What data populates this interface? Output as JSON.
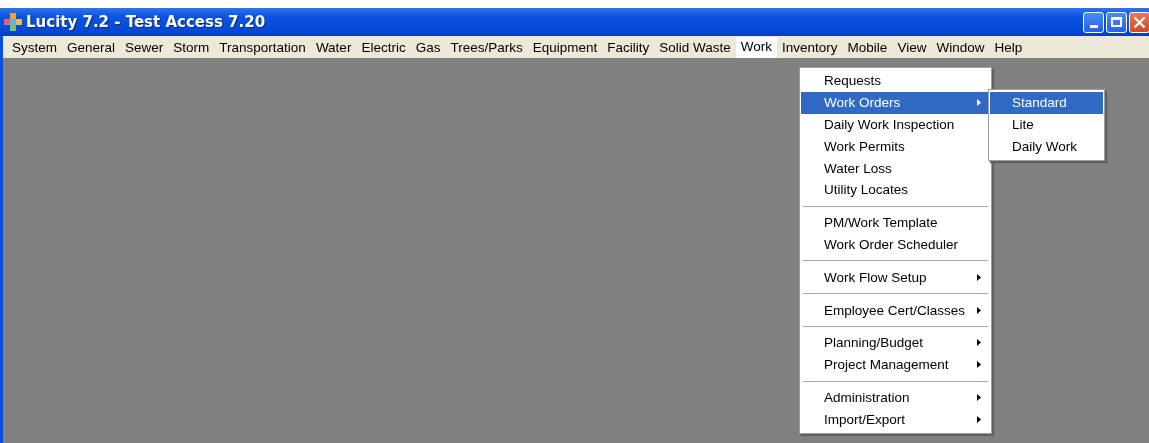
{
  "window": {
    "title": "Lucity 7.2 - Test Access 7.20"
  },
  "menubar": [
    {
      "label": "System",
      "selected": false
    },
    {
      "label": "General",
      "selected": false
    },
    {
      "label": "Sewer",
      "selected": false
    },
    {
      "label": "Storm",
      "selected": false
    },
    {
      "label": "Transportation",
      "selected": false
    },
    {
      "label": "Water",
      "selected": false
    },
    {
      "label": "Electric",
      "selected": false
    },
    {
      "label": "Gas",
      "selected": false
    },
    {
      "label": "Trees/Parks",
      "selected": false
    },
    {
      "label": "Equipment",
      "selected": false
    },
    {
      "label": "Facility",
      "selected": false
    },
    {
      "label": "Solid Waste",
      "selected": false
    },
    {
      "label": "Work",
      "selected": true
    },
    {
      "label": "Inventory",
      "selected": false
    },
    {
      "label": "Mobile",
      "selected": false
    },
    {
      "label": "View",
      "selected": false
    },
    {
      "label": "Window",
      "selected": false
    },
    {
      "label": "Help",
      "selected": false
    }
  ],
  "dropdown": [
    {
      "kind": "item",
      "label": "Requests",
      "selected": false,
      "submenu": false
    },
    {
      "kind": "item",
      "label": "Work Orders",
      "selected": true,
      "submenu": true
    },
    {
      "kind": "item",
      "label": "Daily Work Inspection",
      "selected": false,
      "submenu": false
    },
    {
      "kind": "item",
      "label": "Work Permits",
      "selected": false,
      "submenu": false
    },
    {
      "kind": "item",
      "label": "Water Loss",
      "selected": false,
      "submenu": false
    },
    {
      "kind": "item",
      "label": "Utility Locates",
      "selected": false,
      "submenu": false
    },
    {
      "kind": "separator"
    },
    {
      "kind": "item",
      "label": "PM/Work Template",
      "selected": false,
      "submenu": false
    },
    {
      "kind": "item",
      "label": "Work Order Scheduler",
      "selected": false,
      "submenu": false
    },
    {
      "kind": "separator"
    },
    {
      "kind": "item",
      "label": "Work Flow Setup",
      "selected": false,
      "submenu": true
    },
    {
      "kind": "separator"
    },
    {
      "kind": "item",
      "label": "Employee Cert/Classes",
      "selected": false,
      "submenu": true
    },
    {
      "kind": "separator"
    },
    {
      "kind": "item",
      "label": "Planning/Budget",
      "selected": false,
      "submenu": true
    },
    {
      "kind": "item",
      "label": "Project Management",
      "selected": false,
      "submenu": true
    },
    {
      "kind": "separator"
    },
    {
      "kind": "item",
      "label": "Administration",
      "selected": false,
      "submenu": true
    },
    {
      "kind": "item",
      "label": "Import/Export",
      "selected": false,
      "submenu": true
    }
  ],
  "submenu": [
    {
      "label": "Standard",
      "selected": true
    },
    {
      "label": "Lite",
      "selected": false
    },
    {
      "label": "Daily Work",
      "selected": false
    }
  ]
}
